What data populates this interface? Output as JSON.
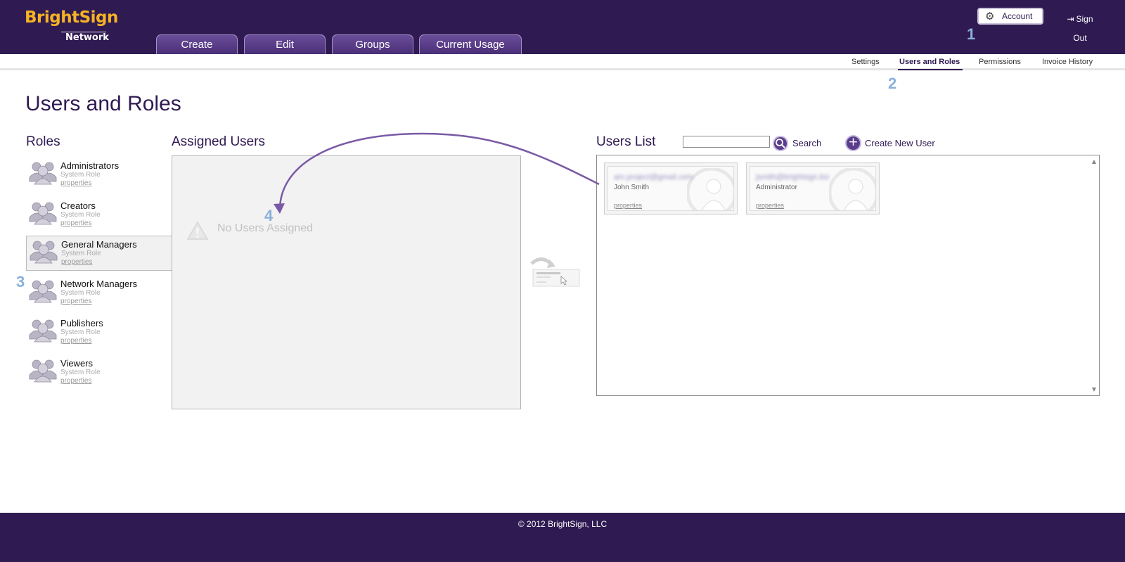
{
  "brand": {
    "name": "BrightSign",
    "sub": "Network",
    "color": "#f5b324"
  },
  "header": {
    "tabs": [
      "Create",
      "Edit",
      "Groups",
      "Current Usage"
    ],
    "account_label": "Account",
    "account_icon": "gear-icon",
    "signout_label": "Sign Out",
    "signout_icon": "exit-icon"
  },
  "subnav": {
    "items": [
      "Settings",
      "Users and Roles",
      "Permissions",
      "Invoice History"
    ],
    "active": "Users and Roles"
  },
  "steps": [
    "1",
    "2",
    "3",
    "4"
  ],
  "page": {
    "title": "Users and Roles"
  },
  "roles": {
    "title": "Roles",
    "items": [
      {
        "name": "Administrators",
        "type": "System Role",
        "link": "properties"
      },
      {
        "name": "Creators",
        "type": "System Role",
        "link": "properties"
      },
      {
        "name": "General Managers",
        "type": "System Role",
        "link": "properties",
        "selected": true
      },
      {
        "name": "Network Managers",
        "type": "System Role",
        "link": "properties"
      },
      {
        "name": "Publishers",
        "type": "System Role",
        "link": "properties"
      },
      {
        "name": "Viewers",
        "type": "System Role",
        "link": "properties"
      }
    ]
  },
  "assigned": {
    "title": "Assigned Users",
    "empty_message": "No Users Assigned"
  },
  "users": {
    "title": "Users List",
    "search_value": "",
    "search_label": "Search",
    "create_label": "Create New User",
    "items": [
      {
        "email": "am.project@gmail.com",
        "name": "John Smith",
        "link": "properties"
      },
      {
        "email": "jsmith@brightsign.biz",
        "name": "Administrator",
        "link": "properties"
      }
    ]
  },
  "footer": {
    "copyright": "© 2012 BrightSign, LLC"
  },
  "colors": {
    "primary": "#2f1a52",
    "accent": "#f5b324",
    "step": "#8ab0dc",
    "arrow": "#7a5aa6"
  }
}
